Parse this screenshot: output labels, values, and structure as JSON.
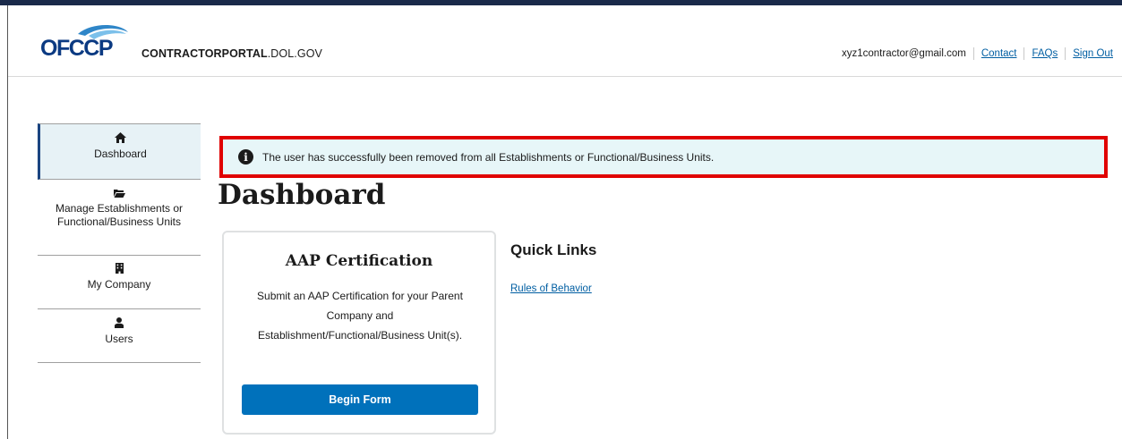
{
  "header": {
    "logo_text": "OFCCP",
    "site_name_bold": "CONTRACTORPORTAL",
    "site_name_rest": ".DOL.GOV",
    "user_email": "xyz1contractor@gmail.com",
    "links": [
      "Contact",
      "FAQs",
      "Sign Out"
    ]
  },
  "sidebar": {
    "items": [
      {
        "icon": "home-icon",
        "label": "Dashboard",
        "active": true
      },
      {
        "icon": "folder-open-icon",
        "label": "Manage Establishments or Functional/Business Units",
        "active": false
      },
      {
        "icon": "building-icon",
        "label": "My Company",
        "active": false
      },
      {
        "icon": "user-icon",
        "label": "Users",
        "active": false
      }
    ]
  },
  "alert": {
    "icon": "info-icon",
    "glyph": "i",
    "message": "The user has successfully been removed from all Establishments or Functional/Business Units.",
    "highlight_color": "#e00000"
  },
  "main": {
    "title": "Dashboard",
    "card": {
      "title": "AAP Certification",
      "body": "Submit an AAP Certification for your Parent Company and Establishment/Functional/Business Unit(s).",
      "button_label": "Begin Form"
    },
    "quick_links": {
      "title": "Quick Links",
      "links": [
        "Rules of Behavior"
      ]
    }
  },
  "colors": {
    "accent": "#0071bb",
    "link": "#005ea2",
    "alert_bg": "#e7f6f8",
    "nav_active_bg": "#e7f2f6",
    "logo_blue": "#0b3a82"
  }
}
